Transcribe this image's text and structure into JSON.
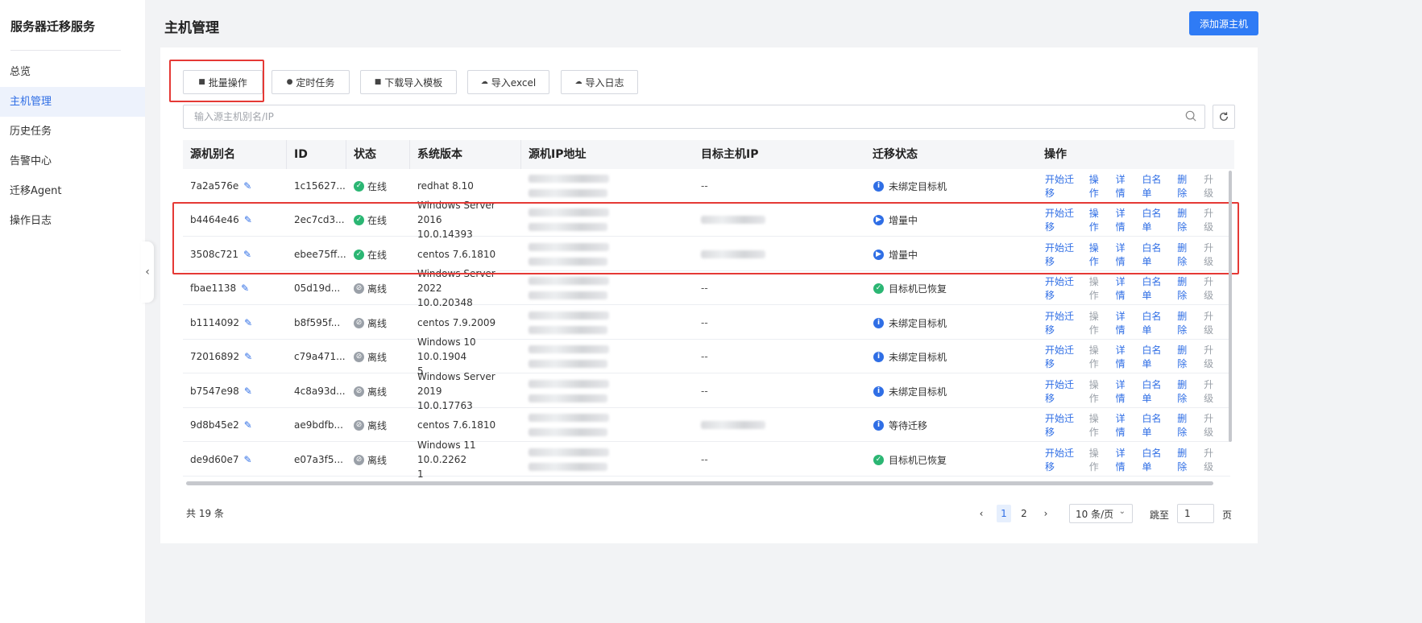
{
  "sidebar": {
    "title": "服务器迁移服务",
    "items": [
      {
        "label": "总览",
        "active": false
      },
      {
        "label": "主机管理",
        "active": true
      },
      {
        "label": "历史任务",
        "active": false
      },
      {
        "label": "告警中心",
        "active": false
      },
      {
        "label": "迁移Agent",
        "active": false
      },
      {
        "label": "操作日志",
        "active": false
      }
    ]
  },
  "header": {
    "title": "主机管理",
    "add_button": "添加源主机"
  },
  "toolbar": {
    "batch": "批量操作",
    "schedule": "定时任务",
    "download_template": "下载导入模板",
    "import_excel": "导入excel",
    "import_log": "导入日志"
  },
  "search": {
    "placeholder": "输入源主机别名/IP"
  },
  "table": {
    "columns": [
      "源机别名",
      "ID",
      "状态",
      "系统版本",
      "源机IP地址",
      "目标主机IP",
      "迁移状态",
      "操作"
    ],
    "actions": [
      "开始迁移",
      "操作",
      "详情",
      "白名单",
      "删除",
      "升级"
    ],
    "rows": [
      {
        "alias": "7a2a576e",
        "id": "1c15627...",
        "status": "在线",
        "os1": "redhat 8.10",
        "os2": "",
        "target": "--",
        "migration": "未绑定目标机",
        "mig_type": "info"
      },
      {
        "alias": "b4464e46",
        "id": "2ec7cd3...",
        "status": "在线",
        "os1": "Windows Server 2016",
        "os2": "10.0.14393",
        "target": "",
        "migration": "增量中",
        "mig_type": "play"
      },
      {
        "alias": "3508c721",
        "id": "ebee75ff...",
        "status": "在线",
        "os1": "centos 7.6.1810",
        "os2": "",
        "target": "",
        "migration": "增量中",
        "mig_type": "play"
      },
      {
        "alias": "fbae1138",
        "id": "05d19d...",
        "status": "离线",
        "os1": "Windows Server 2022",
        "os2": "10.0.20348",
        "target": "--",
        "migration": "目标机已恢复",
        "mig_type": "ok"
      },
      {
        "alias": "b1114092",
        "id": "b8f595f...",
        "status": "离线",
        "os1": "centos 7.9.2009",
        "os2": "",
        "target": "--",
        "migration": "未绑定目标机",
        "mig_type": "info"
      },
      {
        "alias": "72016892",
        "id": "c79a471...",
        "status": "离线",
        "os1": "Windows 10 10.0.1904",
        "os2": "5",
        "target": "--",
        "migration": "未绑定目标机",
        "mig_type": "info"
      },
      {
        "alias": "b7547e98",
        "id": "4c8a93d...",
        "status": "离线",
        "os1": "Windows Server 2019",
        "os2": "10.0.17763",
        "target": "--",
        "migration": "未绑定目标机",
        "mig_type": "info"
      },
      {
        "alias": "9d8b45e2",
        "id": "ae9bdfb...",
        "status": "离线",
        "os1": "centos 7.6.1810",
        "os2": "",
        "target": "",
        "migration": "等待迁移",
        "mig_type": "info"
      },
      {
        "alias": "de9d60e7",
        "id": "e07a3f5...",
        "status": "离线",
        "os1": "Windows 11 10.0.2262",
        "os2": "1",
        "target": "--",
        "migration": "目标机已恢复",
        "mig_type": "ok"
      }
    ]
  },
  "footer": {
    "total": "共 19 条",
    "pages": [
      "1",
      "2"
    ],
    "current_page": "1",
    "page_size": "10 条/页",
    "goto_label": "跳至",
    "goto_value": "1",
    "page_unit": "页"
  },
  "colors": {
    "accent": "#2f6ee5",
    "primary_button": "#2f7bf5",
    "online": "#2bb673",
    "offline": "#9aa0a8",
    "highlight": "#e53935"
  }
}
